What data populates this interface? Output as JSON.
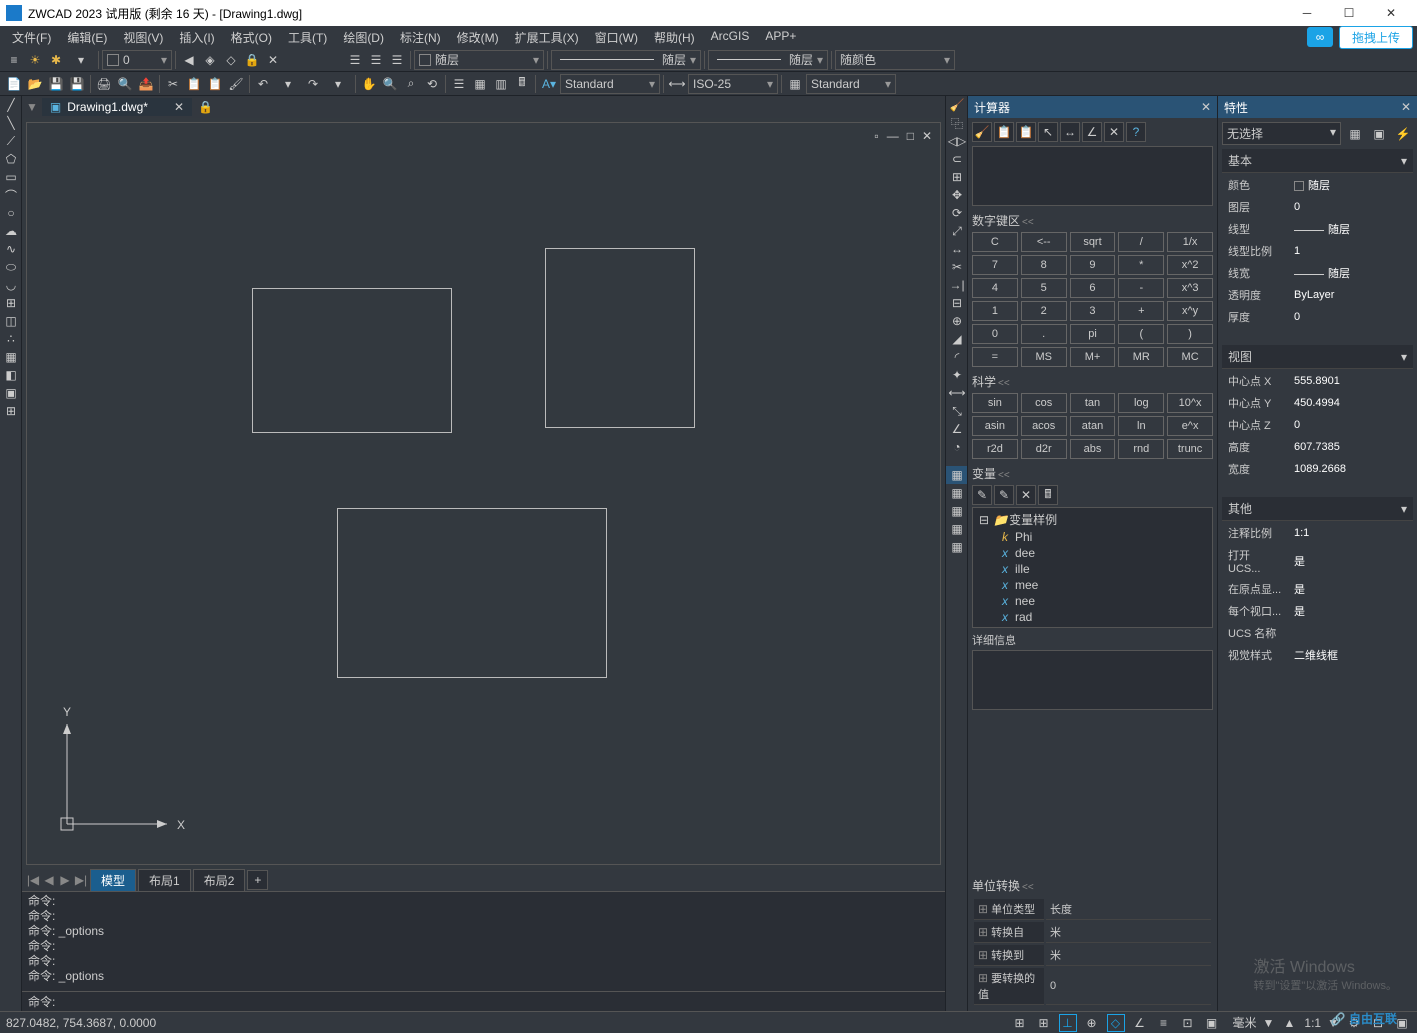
{
  "title": "ZWCAD 2023 试用版 (剩余 16 天) - [Drawing1.dwg]",
  "menus": [
    "文件(F)",
    "编辑(E)",
    "视图(V)",
    "插入(I)",
    "格式(O)",
    "工具(T)",
    "绘图(D)",
    "标注(N)",
    "修改(M)",
    "扩展工具(X)",
    "窗口(W)",
    "帮助(H)",
    "ArcGIS",
    "APP+"
  ],
  "upload_label": "拖拽上传",
  "combo_layer": "随层",
  "combo_linetype": "随层",
  "combo_lineweight": "随层",
  "combo_color": "随颜色",
  "combo_textstyle": "Standard",
  "combo_dimstyle": "ISO-25",
  "combo_tablestyle": "Standard",
  "doc_tab": "Drawing1.dwg*",
  "layout_tabs": {
    "model": "模型",
    "layout1": "布局1",
    "layout2": "布局2"
  },
  "cmd": {
    "prompt": "命令:",
    "lines": [
      "命令:",
      "命令:",
      "命令: _options",
      "命令:",
      "命令:",
      "命令: _options"
    ]
  },
  "calc": {
    "title": "计算器",
    "numpad_title": "数字键区",
    "sci_title": "科学",
    "var_title": "变量",
    "unit_title": "单位转换",
    "keys_num": [
      "C",
      "<--",
      "sqrt",
      "/",
      "1/x",
      "7",
      "8",
      "9",
      "*",
      "x^2",
      "4",
      "5",
      "6",
      "-",
      "x^3",
      "1",
      "2",
      "3",
      "+",
      "x^y",
      "0",
      ".",
      "pi",
      "(",
      ")",
      "=",
      "MS",
      "M+",
      "MR",
      "MC"
    ],
    "keys_sci": [
      "sin",
      "cos",
      "tan",
      "log",
      "10^x",
      "asin",
      "acos",
      "atan",
      "ln",
      "e^x",
      "r2d",
      "d2r",
      "abs",
      "rnd",
      "trunc"
    ],
    "var_root": "变量样例",
    "vars": [
      "Phi",
      "dee",
      "ille",
      "mee",
      "nee",
      "rad"
    ],
    "detail": "详细信息",
    "unit_rows": [
      [
        "单位类型",
        "长度"
      ],
      [
        "转换自",
        "米"
      ],
      [
        "转换到",
        "米"
      ],
      [
        "要转换的值",
        "0"
      ]
    ]
  },
  "props": {
    "title": "特性",
    "no_selection": "无选择",
    "sections": {
      "basic": {
        "title": "基本",
        "rows": [
          [
            "颜色",
            "随层",
            "sw"
          ],
          [
            "图层",
            "0",
            ""
          ],
          [
            "线型",
            "随层",
            "ln"
          ],
          [
            "线型比例",
            "1",
            ""
          ],
          [
            "线宽",
            "随层",
            "ln"
          ],
          [
            "透明度",
            "ByLayer",
            ""
          ],
          [
            "厚度",
            "0",
            ""
          ]
        ]
      },
      "view": {
        "title": "视图",
        "rows": [
          [
            "中心点 X",
            "555.8901",
            ""
          ],
          [
            "中心点 Y",
            "450.4994",
            ""
          ],
          [
            "中心点 Z",
            "0",
            ""
          ],
          [
            "高度",
            "607.7385",
            ""
          ],
          [
            "宽度",
            "1089.2668",
            ""
          ]
        ]
      },
      "other": {
        "title": "其他",
        "rows": [
          [
            "注释比例",
            "1:1",
            ""
          ],
          [
            "打开 UCS...",
            "是",
            ""
          ],
          [
            "在原点显...",
            "是",
            ""
          ],
          [
            "每个视口...",
            "是",
            ""
          ],
          [
            "UCS 名称",
            "",
            ""
          ],
          [
            "视觉样式",
            "二维线框",
            ""
          ]
        ]
      }
    }
  },
  "status": {
    "coords": "827.0482, 754.3687, 0.0000",
    "right": "毫米",
    "scale": "1:1"
  },
  "watermark": {
    "l1": "激活 Windows",
    "l2": "转到\"设置\"以激活 Windows。",
    "brand": "自由互联"
  }
}
